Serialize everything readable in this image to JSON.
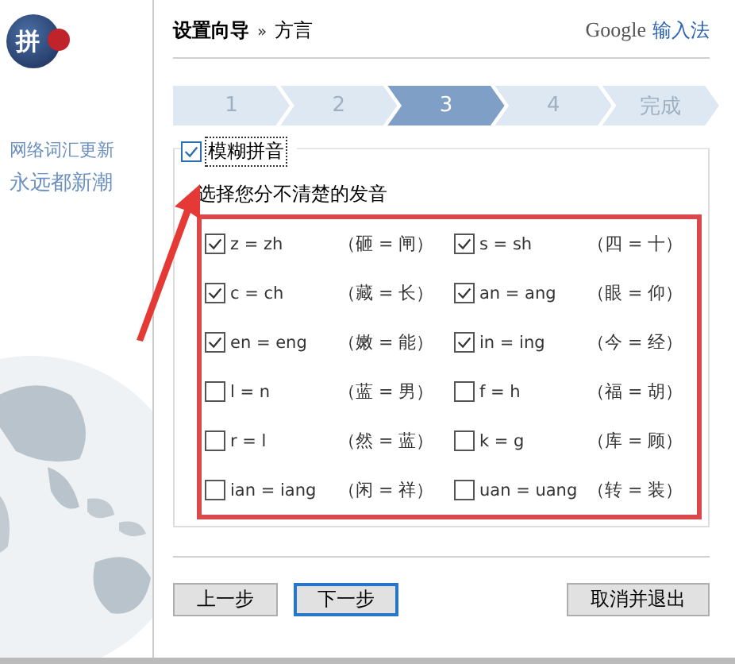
{
  "sidebar": {
    "logo_char": "拼",
    "slogan": [
      "网络词汇更新",
      "永远都新潮"
    ]
  },
  "header": {
    "title": "设置向导",
    "separator": "»",
    "subtitle": "方言",
    "brand": "Google",
    "product": "输入法"
  },
  "steps": [
    {
      "label": "1",
      "selected": false
    },
    {
      "label": "2",
      "selected": false
    },
    {
      "label": "3",
      "selected": true
    },
    {
      "label": "4",
      "selected": false
    },
    {
      "label": "完成",
      "selected": false
    }
  ],
  "fuzzy_group": {
    "label": "模糊拼音",
    "checked": true,
    "instruction": "选择您分不清楚的发音",
    "pairs": [
      {
        "label": "z = zh",
        "example": "（砸 = 闸）",
        "checked": true
      },
      {
        "label": "s = sh",
        "example": "（四 = 十）",
        "checked": true
      },
      {
        "label": "c = ch",
        "example": "（藏 = 长）",
        "checked": true
      },
      {
        "label": "an = ang",
        "example": "（眼 = 仰）",
        "checked": true
      },
      {
        "label": "en = eng",
        "example": "（嫩 = 能）",
        "checked": true
      },
      {
        "label": "in = ing",
        "example": "（今 = 经）",
        "checked": true
      },
      {
        "label": "l = n",
        "example": "（蓝 = 男）",
        "checked": false
      },
      {
        "label": "f = h",
        "example": "（福 = 胡）",
        "checked": false
      },
      {
        "label": "r = l",
        "example": "（然 = 蓝）",
        "checked": false
      },
      {
        "label": "k = g",
        "example": "（库 = 顾）",
        "checked": false
      },
      {
        "label": "ian = iang",
        "example": "（闲 = 祥）",
        "checked": false
      },
      {
        "label": "uan = uang",
        "example": "（转 = 装）",
        "checked": false
      }
    ]
  },
  "buttons": [
    {
      "label": "上一步",
      "focused": false
    },
    {
      "label": "下一步",
      "focused": true
    },
    {
      "label": "取消并退出",
      "focused": false
    }
  ]
}
